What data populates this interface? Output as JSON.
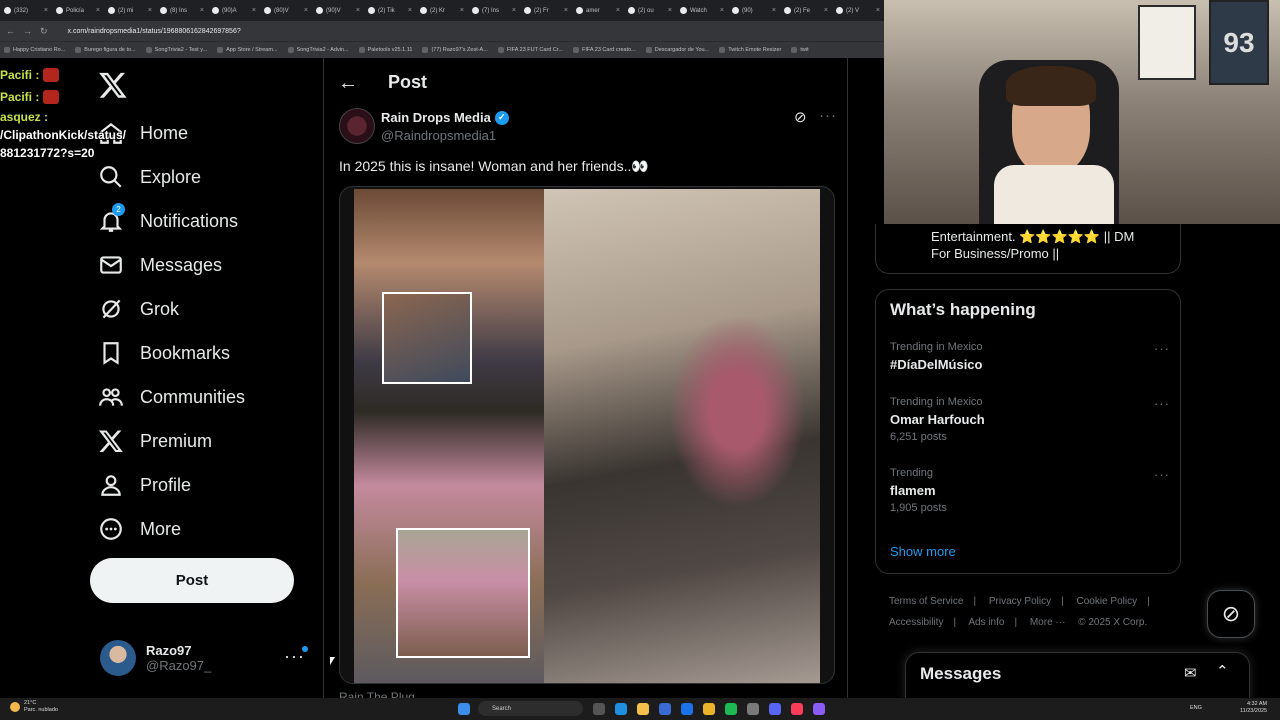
{
  "browser": {
    "tabs": [
      {
        "label": "(332)"
      },
      {
        "label": "Policía"
      },
      {
        "label": "(2) mi"
      },
      {
        "label": "(8) Ins"
      },
      {
        "label": "(90)A"
      },
      {
        "label": "(80)V"
      },
      {
        "label": "(90)V"
      },
      {
        "label": "(2) Tik"
      },
      {
        "label": "(2) Kr"
      },
      {
        "label": "(7) Ins"
      },
      {
        "label": "(2) Fr"
      },
      {
        "label": "amer"
      },
      {
        "label": "(2) ou"
      },
      {
        "label": "Watch"
      },
      {
        "label": "(90)"
      },
      {
        "label": "(2) Fe"
      },
      {
        "label": "(2) V"
      }
    ],
    "url": "x.com/raindropsmedia1/status/1968806162842697856?",
    "bookmarks": [
      "Happy Cristiano Ro...",
      "Burego figura de to...",
      "SongTrivia2 - Test y...",
      "App Store / Stream...",
      "SongTrivia2 - Advin...",
      "Paletools v25.1.11",
      "(77) Razo97's Zest-A...",
      "FIFA 23 FUT Card Cr...",
      "FIFA 23 Card creato...",
      "Descargador de You...",
      "Twitch Emote Resizer",
      "twit"
    ]
  },
  "chat": {
    "lines": [
      {
        "name": "Pacifi :"
      },
      {
        "name": "Pacifi :"
      }
    ],
    "link_lines": [
      "asquez :",
      "/ClipathonKick/status/",
      "881231772?s=20"
    ]
  },
  "nav": {
    "items": [
      {
        "label": "Home",
        "icon": "home-icon"
      },
      {
        "label": "Explore",
        "icon": "search-icon"
      },
      {
        "label": "Notifications",
        "icon": "bell-icon",
        "badge": "2"
      },
      {
        "label": "Messages",
        "icon": "envelope-icon"
      },
      {
        "label": "Grok",
        "icon": "grok-icon"
      },
      {
        "label": "Bookmarks",
        "icon": "bookmark-icon"
      },
      {
        "label": "Communities",
        "icon": "people-icon"
      },
      {
        "label": "Premium",
        "icon": "x-icon"
      },
      {
        "label": "Profile",
        "icon": "person-icon"
      },
      {
        "label": "More",
        "icon": "more-circle-icon"
      }
    ],
    "post_label": "Post",
    "account": {
      "name": "Razo97",
      "handle": "@Razo97_"
    }
  },
  "main": {
    "header_title": "Post",
    "tweet": {
      "author_name": "Rain Drops Media",
      "author_handle": "@Raindropsmedia1",
      "text": "In 2025 this is insane! Woman and her friends..👀",
      "next_author": "Rain The Plug"
    }
  },
  "right": {
    "bio_line1": "Entertainment. ⭐⭐⭐⭐⭐ || DM",
    "bio_line2": "For Business/Promo ||",
    "trends_title": "What’s happening",
    "trends": [
      {
        "context": "Trending in Mexico",
        "name": "#DíaDelMúsico",
        "count": ""
      },
      {
        "context": "Trending in Mexico",
        "name": "Omar Harfouch",
        "count": "6,251 posts"
      },
      {
        "context": "Trending",
        "name": "flamem",
        "count": "1,905 posts"
      }
    ],
    "show_more": "Show more",
    "footer": {
      "terms": "Terms of Service",
      "privacy": "Privacy Policy",
      "cookie": "Cookie Policy",
      "accessibility": "Accessibility",
      "ads": "Ads info",
      "more": "More ···",
      "copyright": "© 2025 X Corp."
    },
    "messages_title": "Messages"
  },
  "webcam": {
    "jersey_number": "93"
  },
  "taskbar": {
    "weather_temp": "21°C",
    "weather_desc": "Parc. nublado",
    "search": "Search",
    "lang": "ENG",
    "time": "4:32 AM",
    "date": "11/23/2025"
  },
  "colors": {
    "accent": "#1d9bf0",
    "background": "#000000",
    "border": "#2f3336",
    "muted": "#71767b"
  }
}
